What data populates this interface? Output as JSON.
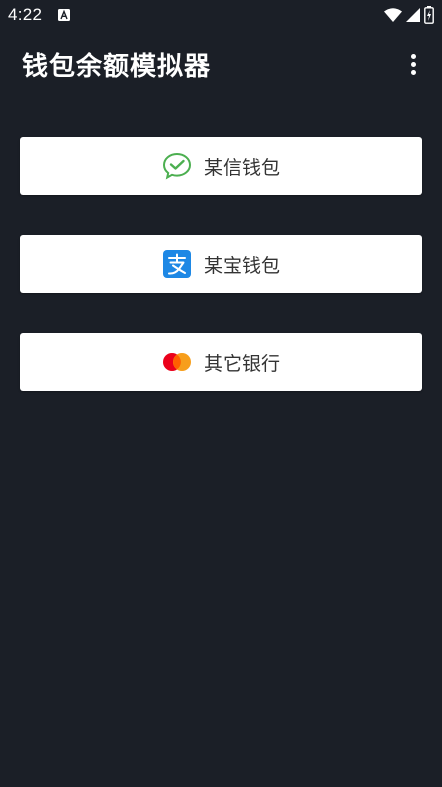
{
  "status_bar": {
    "time": "4:22"
  },
  "app_bar": {
    "title": "钱包余额模拟器"
  },
  "wallets": [
    {
      "label": "某信钱包",
      "icon": "wechat-icon",
      "color": "#4caf50"
    },
    {
      "label": "某宝钱包",
      "icon": "alipay-icon",
      "color": "#1e88e5"
    },
    {
      "label": "其它银行",
      "icon": "mastercard-icon",
      "color": "#eb001b"
    }
  ],
  "colors": {
    "background": "#1b1f27",
    "button": "#ffffff",
    "text_primary": "#ffffff",
    "button_text": "#333333"
  }
}
